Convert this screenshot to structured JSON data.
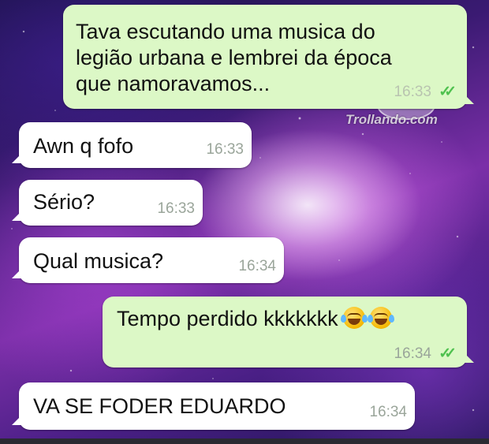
{
  "watermark": {
    "text": "Trollando.com",
    "icon": "troll-face-icon"
  },
  "colors": {
    "outgoing_bubble": "#dcf8c6",
    "incoming_bubble": "#ffffff",
    "read_ticks": "#4fc14f",
    "timestamp": "#9aa59a"
  },
  "messages": [
    {
      "direction": "outgoing",
      "text": "Tava escutando uma musica do\nlegião urbana e lembrei da época\nque namoravamos...",
      "time": "16:33",
      "ticks": "✓✓"
    },
    {
      "direction": "incoming",
      "text": "Awn q fofo",
      "time": "16:33"
    },
    {
      "direction": "incoming",
      "text": "Sério?",
      "time": "16:33"
    },
    {
      "direction": "incoming",
      "text": "Qual musica?",
      "time": "16:34"
    },
    {
      "direction": "outgoing",
      "text": "Tempo perdido kkkkkkk",
      "emojis": [
        "face-with-tears-of-joy-icon",
        "face-with-tears-of-joy-icon"
      ],
      "time": "16:34",
      "ticks": "✓✓"
    },
    {
      "direction": "incoming",
      "text": "VA SE FODER EDUARDO",
      "time": "16:34"
    }
  ]
}
